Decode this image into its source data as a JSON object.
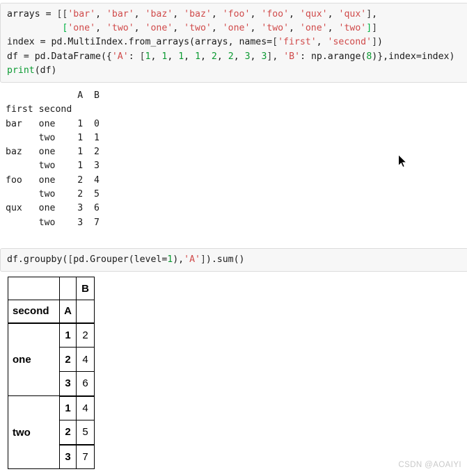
{
  "cells": {
    "input_1": {
      "lines": [
        [
          {
            "t": "arrays = ",
            "c": "plain"
          },
          {
            "t": "[[",
            "c": "br-0"
          },
          {
            "t": "'bar'",
            "c": "str"
          },
          {
            "t": ", ",
            "c": "plain"
          },
          {
            "t": "'bar'",
            "c": "str"
          },
          {
            "t": ", ",
            "c": "plain"
          },
          {
            "t": "'baz'",
            "c": "str"
          },
          {
            "t": ", ",
            "c": "plain"
          },
          {
            "t": "'baz'",
            "c": "str"
          },
          {
            "t": ", ",
            "c": "plain"
          },
          {
            "t": "'foo'",
            "c": "str"
          },
          {
            "t": ", ",
            "c": "plain"
          },
          {
            "t": "'foo'",
            "c": "str"
          },
          {
            "t": ", ",
            "c": "plain"
          },
          {
            "t": "'qux'",
            "c": "str"
          },
          {
            "t": ", ",
            "c": "plain"
          },
          {
            "t": "'qux'",
            "c": "str"
          },
          {
            "t": "]",
            "c": "br-0"
          },
          {
            "t": ",",
            "c": "plain"
          }
        ],
        [
          {
            "t": "          ",
            "c": "plain"
          },
          {
            "t": "[",
            "c": "br-1"
          },
          {
            "t": "'one'",
            "c": "str"
          },
          {
            "t": ", ",
            "c": "plain"
          },
          {
            "t": "'two'",
            "c": "str"
          },
          {
            "t": ", ",
            "c": "plain"
          },
          {
            "t": "'one'",
            "c": "str"
          },
          {
            "t": ", ",
            "c": "plain"
          },
          {
            "t": "'two'",
            "c": "str"
          },
          {
            "t": ", ",
            "c": "plain"
          },
          {
            "t": "'one'",
            "c": "str"
          },
          {
            "t": ", ",
            "c": "plain"
          },
          {
            "t": "'two'",
            "c": "str"
          },
          {
            "t": ", ",
            "c": "plain"
          },
          {
            "t": "'one'",
            "c": "str"
          },
          {
            "t": ", ",
            "c": "plain"
          },
          {
            "t": "'two'",
            "c": "str"
          },
          {
            "t": "]",
            "c": "br-1"
          },
          {
            "t": "]",
            "c": "br-0"
          }
        ],
        [
          {
            "t": "index = pd.MultiIndex.from_arrays(arrays, names=",
            "c": "plain"
          },
          {
            "t": "[",
            "c": "br-0"
          },
          {
            "t": "'first'",
            "c": "str"
          },
          {
            "t": ", ",
            "c": "plain"
          },
          {
            "t": "'second'",
            "c": "str"
          },
          {
            "t": "]",
            "c": "br-0"
          },
          {
            "t": ")",
            "c": "plain"
          }
        ],
        [
          {
            "t": "df = pd.DataFrame({",
            "c": "plain"
          },
          {
            "t": "'A'",
            "c": "str"
          },
          {
            "t": ": ",
            "c": "plain"
          },
          {
            "t": "[",
            "c": "br-0"
          },
          {
            "t": "1",
            "c": "num"
          },
          {
            "t": ", ",
            "c": "plain"
          },
          {
            "t": "1",
            "c": "num"
          },
          {
            "t": ", ",
            "c": "plain"
          },
          {
            "t": "1",
            "c": "num"
          },
          {
            "t": ", ",
            "c": "plain"
          },
          {
            "t": "1",
            "c": "num"
          },
          {
            "t": ", ",
            "c": "plain"
          },
          {
            "t": "2",
            "c": "num"
          },
          {
            "t": ", ",
            "c": "plain"
          },
          {
            "t": "2",
            "c": "num"
          },
          {
            "t": ", ",
            "c": "plain"
          },
          {
            "t": "3",
            "c": "num"
          },
          {
            "t": ", ",
            "c": "plain"
          },
          {
            "t": "3",
            "c": "num"
          },
          {
            "t": "]",
            "c": "br-0"
          },
          {
            "t": ", ",
            "c": "plain"
          },
          {
            "t": "'B'",
            "c": "str"
          },
          {
            "t": ": np.arange(",
            "c": "plain"
          },
          {
            "t": "8",
            "c": "num"
          },
          {
            "t": ")},index=index)",
            "c": "plain"
          }
        ],
        [
          {
            "t": "print",
            "c": "func"
          },
          {
            "t": "(df)",
            "c": "plain"
          }
        ]
      ]
    },
    "input_2": {
      "lines": [
        [
          {
            "t": "df.groupby(",
            "c": "plain"
          },
          {
            "t": "[",
            "c": "br-0"
          },
          {
            "t": "pd.Grouper(level=",
            "c": "plain"
          },
          {
            "t": "1",
            "c": "num"
          },
          {
            "t": "),",
            "c": "plain"
          },
          {
            "t": "'A'",
            "c": "str"
          },
          {
            "t": "]",
            "c": "br-0"
          },
          {
            "t": ").sum()",
            "c": "plain"
          }
        ]
      ]
    }
  },
  "stdout": {
    "text": "             A  B\nfirst second      \nbar   one    1  0\n      two    1  1\nbaz   one    1  2\n      two    1  3\nfoo   one    2  4\n      two    2  5\nqux   one    3  6\n      two    3  7"
  },
  "result_table": {
    "header_rows": [
      {
        "index_label": "",
        "a_label": "",
        "b_label": "B"
      },
      {
        "index_label": "second",
        "a_label": "A",
        "b_label": ""
      }
    ],
    "groups": [
      {
        "label": "one",
        "rows": [
          {
            "a": "1",
            "b": "2"
          },
          {
            "a": "2",
            "b": "4"
          },
          {
            "a": "3",
            "b": "6"
          }
        ]
      },
      {
        "label": "two",
        "rows": [
          {
            "a": "1",
            "b": "4"
          },
          {
            "a": "2",
            "b": "5"
          },
          {
            "a": "3",
            "b": "7"
          }
        ]
      }
    ]
  },
  "watermark": {
    "text": "CSDN @AOAIYI"
  },
  "colors": {
    "cell_background": "#f7f7f7",
    "cell_border": "#dcdcdc",
    "string_token": "#d04a4a",
    "number_token": "#0b9a32",
    "builtin_token": "#0b9a32",
    "bracket_level_0": "#3a3a3a",
    "bracket_level_1": "#00b140",
    "table_border": "#000000",
    "watermark": "#c9c9c9"
  }
}
